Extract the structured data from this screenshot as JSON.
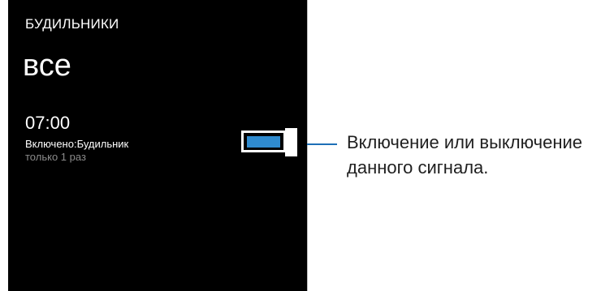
{
  "app": {
    "title": "БУДИЛЬНИКИ",
    "page": "все"
  },
  "alarm": {
    "time": "07:00",
    "status": "Включено:Будильник",
    "repeat": "только 1 раз",
    "enabled": true
  },
  "annotation": {
    "line1": "Включение или выключение",
    "line2": "данного сигнала."
  },
  "colors": {
    "screen_background": "#000000",
    "toggle_on": "#2f8bcf",
    "secondary_text": "#8b8b8b",
    "callout_line": "#1d6fb7"
  }
}
